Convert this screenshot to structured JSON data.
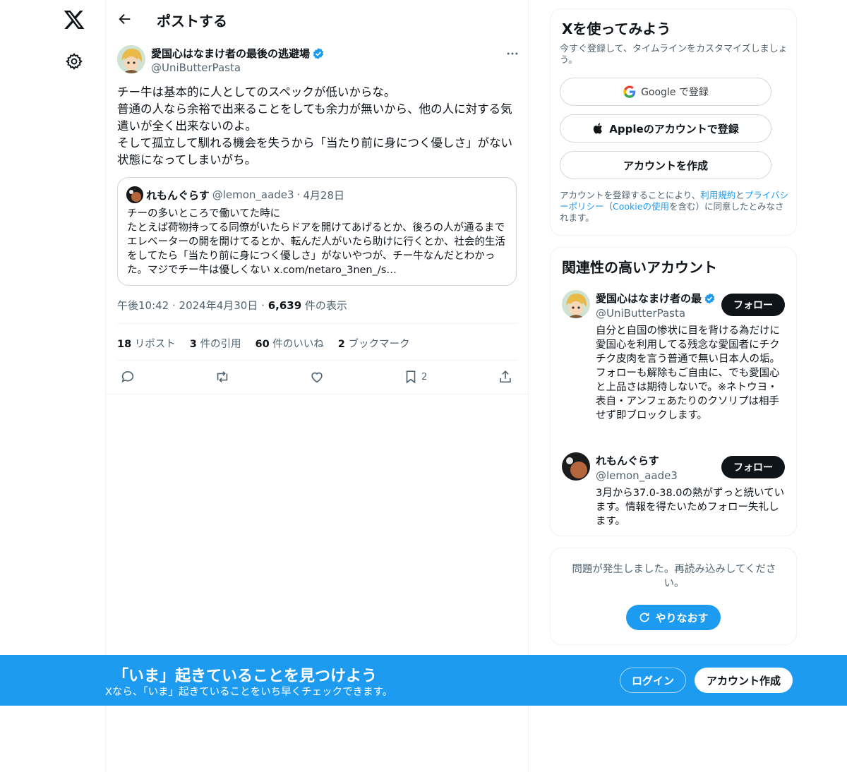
{
  "nav": {
    "logo_icon": "x-logo-icon",
    "settings_icon": "gear-icon"
  },
  "header": {
    "title": "ポストする"
  },
  "tweet": {
    "author_name": "愛国心はなまけ者の最後の逃避場",
    "author_handle": "@UniButterPasta",
    "text": "チー牛は基本的に人としてのスペックが低いからな。\n普通の人なら余裕で出来ることをしても余力が無いから、他の人に対する気遣いが全く出来ないのよ。\nそして孤立して馴れる機会を失うから「当たり前に身につく優しさ」がない状態になってしまいがち。",
    "time": "午後10:42 · 2024年4月30日",
    "dot": "·",
    "views_count": "6,639",
    "views_label": "件の表示",
    "stats": {
      "reposts_count": "18",
      "reposts_label": "リポスト",
      "quotes_count": "3",
      "quotes_label": "件の引用",
      "likes_count": "60",
      "likes_label": "件のいいね",
      "bookmarks_count": "2",
      "bookmarks_label": "ブックマーク"
    },
    "bookmark_action_count": "2"
  },
  "quote": {
    "name": "れもんぐらす",
    "handle": "@lemon_aade3",
    "dot": "·",
    "date": "4月28日",
    "text": "チーの多いところで働いてた時に\nたとえば荷物持ってる同僚がいたらドアを開けてあげるとか、後ろの人が通るまでエレベーターの開を開けてるとか、転んだ人がいたら助けに行くとか、社会的生活をしてたら「当たり前に身につく優しさ」がないやつが、チー牛なんだとわかった。マジでチー牛は優しくない x.com/netaro_3nen_/s…"
  },
  "signup_card": {
    "title": "Xを使ってみよう",
    "subtitle": "今すぐ登録して、タイムラインをカスタマイズしましょう。",
    "google_label": "Google で登録",
    "apple_label": "Appleのアカウントで登録",
    "create_label": "アカウントを作成",
    "legal_1": "アカウントを登録することにより、",
    "legal_terms": "利用規約",
    "legal_2": "と",
    "legal_privacy": "プライバシーポリシー",
    "legal_3": "（",
    "legal_cookie": "Cookieの使用",
    "legal_4": "を含む）に同意したとみなされます。"
  },
  "related": {
    "title": "関連性の高いアカウント",
    "follow_label": "フォロー",
    "accounts": [
      {
        "name": "愛国心はなまけ者の最",
        "handle": "@UniButterPasta",
        "bio": "自分と自国の惨状に目を背ける為だけに 愛国心を利用してる残念な愛国者にチクチク皮肉を言う普通で無い日本人の垢。　フォローも解除もご自由に、でも愛国心と上品さは期待しないで。※ネトウヨ・表自・アンフェあたりのクソリプは相手せず即ブロックします。"
      },
      {
        "name": "れもんぐらす",
        "handle": "@lemon_aade3",
        "bio": "3月から37.0-38.0の熱がずっと続いています。情報を得たいためフォロー失礼します。"
      }
    ]
  },
  "error_card": {
    "message": "問題が発生しました。再読み込みしてください。",
    "retry_label": "やりなおす"
  },
  "banner": {
    "title": "「いま」起きていることを見つけよう",
    "subtitle": "Xなら、「いま」起きていることをいち早くチェックできます。",
    "login_label": "ログイン",
    "signup_label": "アカウント作成"
  },
  "colors": {
    "accent": "#1d9bf0",
    "text": "#0f1419",
    "muted": "#536471"
  }
}
